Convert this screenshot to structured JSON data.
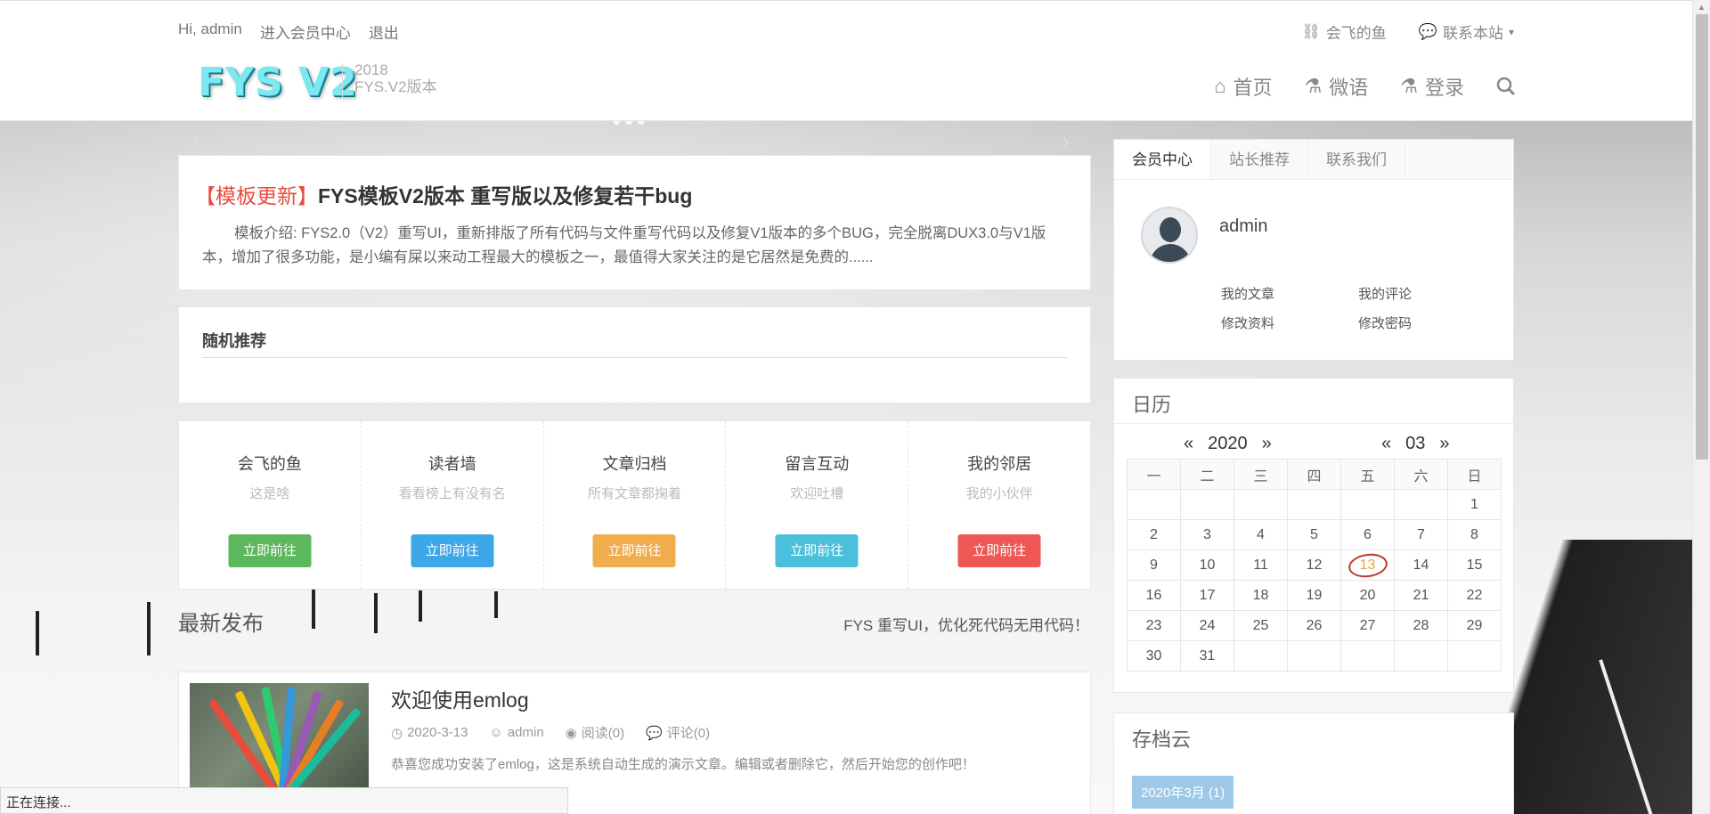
{
  "header": {
    "greeting": "Hi, admin",
    "member_center": "进入会员中心",
    "logout": "退出",
    "right_links": [
      "会飞的鱼",
      "联系本站"
    ],
    "logo": "FYS V2",
    "logo_year": "2018",
    "logo_version": "FYS.V2版本",
    "nav": [
      "首页",
      "微语",
      "登录"
    ]
  },
  "featured": {
    "tag": "【模板更新】",
    "title": "FYS模板V2版本 重写版以及修复若干bug",
    "desc": "模板介绍: FYS2.0（V2）重写UI，重新排版了所有代码与文件重写代码以及修复V1版本的多个BUG，完全脱离DUX3.0与V1版本，增加了很多功能，是小编有屎以来动工程最大的模板之一，最值得大家关注的是它居然是免费的......"
  },
  "random": {
    "title": "随机推荐"
  },
  "links": [
    {
      "title": "会飞的鱼",
      "sub": "这是啥",
      "btn": "立即前往",
      "color": "#5cb85c"
    },
    {
      "title": "读者墙",
      "sub": "看看榜上有没有名",
      "btn": "立即前往",
      "color": "#3ea7e8"
    },
    {
      "title": "文章归档",
      "sub": "所有文章都掬着",
      "btn": "立即前往",
      "color": "#f0ad4e"
    },
    {
      "title": "留言互动",
      "sub": "欢迎吐槽",
      "btn": "立即前往",
      "color": "#4ac0da"
    },
    {
      "title": "我的邻居",
      "sub": "我的小伙伴",
      "btn": "立即前往",
      "color": "#ee5753"
    }
  ],
  "latest": {
    "title": "最新发布",
    "note": "FYS 重写UI，优化死代码无用代码！"
  },
  "post": {
    "title": "欢迎使用emlog",
    "date": "2020-3-13",
    "author": "admin",
    "views": "阅读(0)",
    "comments": "评论(0)",
    "excerpt": "恭喜您成功安装了emlog，这是系统自动生成的演示文章。编辑或者删除它，然后开始您的创作吧！"
  },
  "member": {
    "tabs": [
      "会员中心",
      "站长推荐",
      "联系我们"
    ],
    "username": "admin",
    "links": [
      "我的文章",
      "我的评论",
      "修改资料",
      "修改密码"
    ]
  },
  "calendar": {
    "title": "日历",
    "year": "2020",
    "month": "03",
    "prev": "«",
    "next": "»",
    "weekdays": [
      "一",
      "二",
      "三",
      "四",
      "五",
      "六",
      "日"
    ],
    "rows": [
      [
        "",
        "",
        "",
        "",
        "",
        "",
        "1"
      ],
      [
        "2",
        "3",
        "4",
        "5",
        "6",
        "7",
        "8"
      ],
      [
        "9",
        "10",
        "11",
        "12",
        "13",
        "14",
        "15"
      ],
      [
        "16",
        "17",
        "18",
        "19",
        "20",
        "21",
        "22"
      ],
      [
        "23",
        "24",
        "25",
        "26",
        "27",
        "28",
        "29"
      ],
      [
        "30",
        "31",
        "",
        "",
        "",
        "",
        ""
      ]
    ],
    "today": "13"
  },
  "archive": {
    "title": "存档云",
    "item": "2020年3月 (1)"
  },
  "status": "正在连接..."
}
